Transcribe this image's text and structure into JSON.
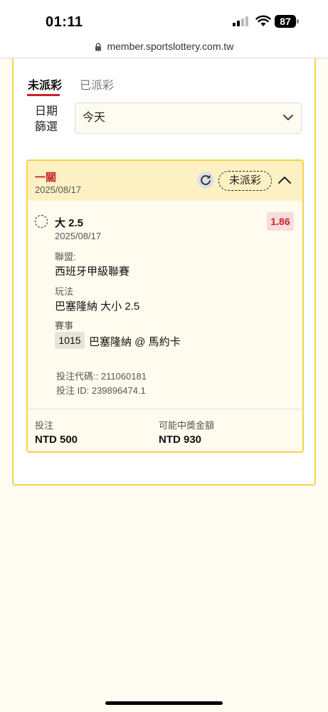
{
  "status_bar": {
    "time": "01:11",
    "battery": "87"
  },
  "browser": {
    "url": "member.sportslottery.com.tw"
  },
  "tabs": {
    "active": "未派彩",
    "inactive": "已派彩"
  },
  "date_filter": {
    "label": "日期篩選",
    "value": "今天"
  },
  "bet": {
    "type": "一關",
    "date": "2025/08/17",
    "status": "未派彩",
    "selection": {
      "name": "大 2.5",
      "odds": "1.86",
      "date": "2025/08/17",
      "league_label": "聯盟:",
      "league": "西班牙甲級聯賽",
      "market_label": "玩法",
      "market": "巴塞隆納 大小 2.5",
      "event_label": "賽事",
      "event_id": "1015",
      "event_name": "巴塞隆納 @ 馬約卡"
    },
    "bet_code": "投注代碼:: 211060181",
    "bet_id": "投注 ID: 239896474.1",
    "stake_label": "投注",
    "stake": "NTD 500",
    "payout_label": "可能中獎金額",
    "payout": "NTD 930"
  },
  "colors": {
    "accent_red": "#c8222a",
    "border_yellow": "#f3d44a",
    "header_bg": "#fdf1c3"
  }
}
